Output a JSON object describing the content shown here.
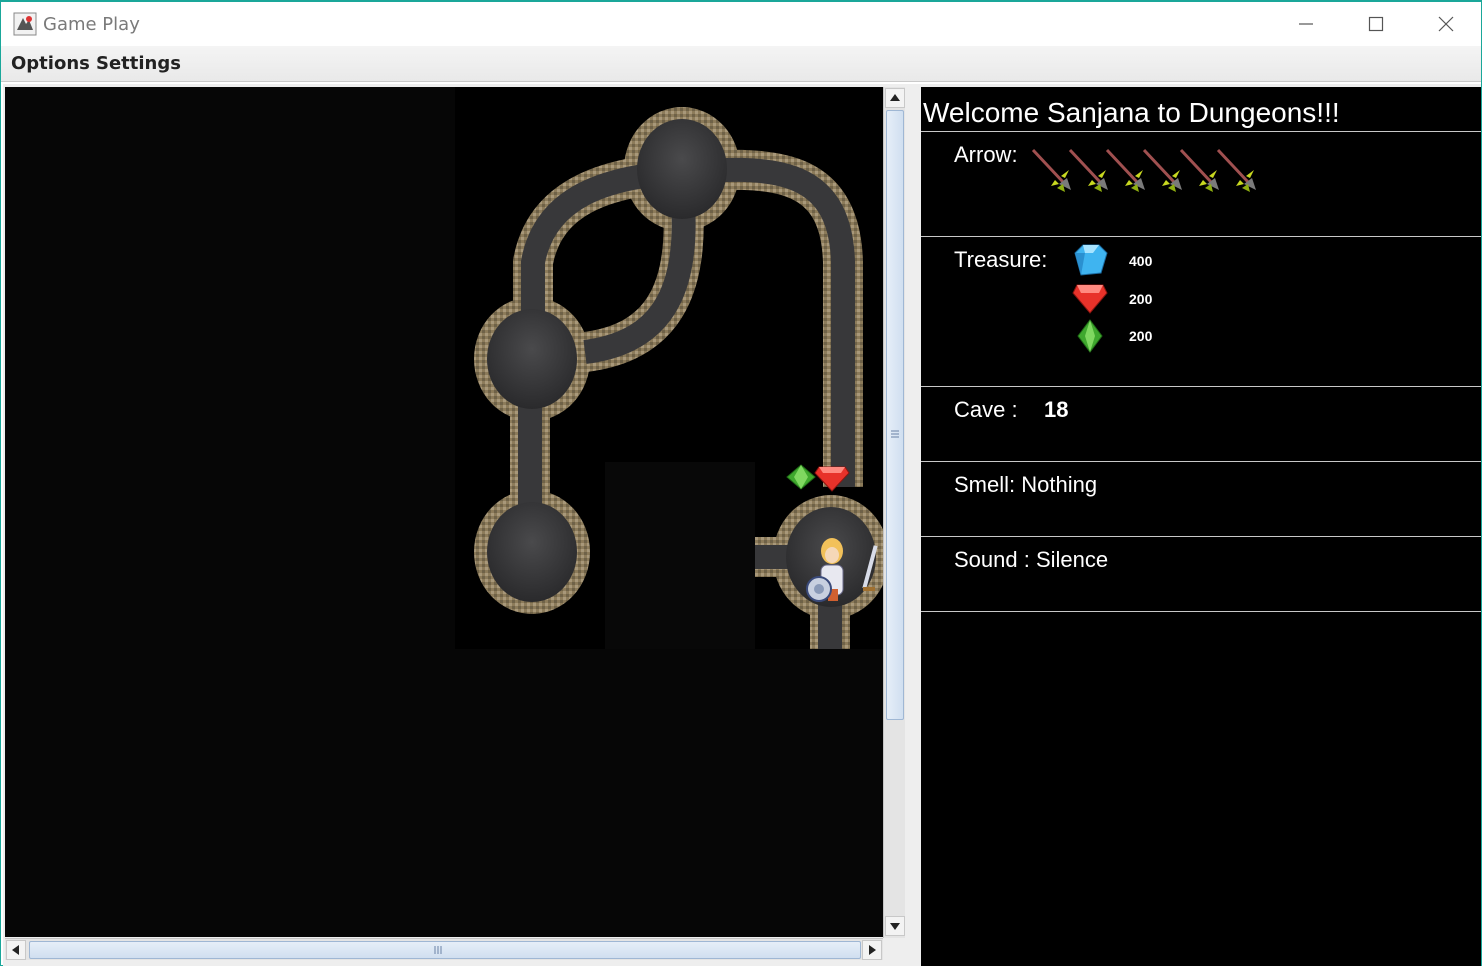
{
  "window": {
    "title": "Game Play",
    "minimize_label": "minimize",
    "maximize_label": "maximize",
    "close_label": "close"
  },
  "menu": {
    "items": [
      {
        "label": "Options"
      },
      {
        "label": "Settings"
      }
    ]
  },
  "info": {
    "welcome": "Welcome Sanjana to Dungeons!!!",
    "arrow_label": "Arrow:",
    "arrow_count": 6,
    "treasure_label": "Treasure:",
    "treasure": [
      {
        "gem": "diamond-icon",
        "color": "#3fb4f0",
        "value": "400"
      },
      {
        "gem": "ruby-icon",
        "color": "#e8322a",
        "value": "200"
      },
      {
        "gem": "emerald-icon",
        "color": "#3fa82e",
        "value": "200"
      }
    ],
    "cave_label": "Cave :",
    "cave_value": "18",
    "smell": "Smell: Nothing",
    "sound": "Sound : Silence"
  },
  "colors": {
    "window_border": "#1aa79a",
    "cave_floor": "#3a3a3c",
    "cave_wall": "#8a7a5c",
    "background": "#060606"
  }
}
